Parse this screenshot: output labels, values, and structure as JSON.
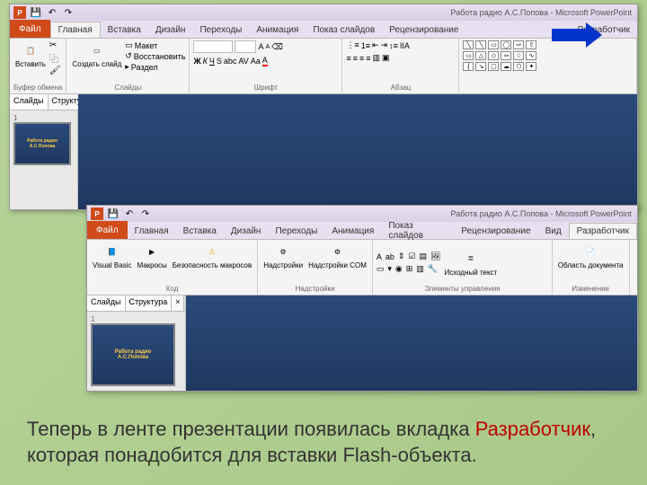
{
  "app": {
    "title1": "Работа радио А.С.Попова - Microsoft PowerPoint",
    "title2": "Работа радио А.С.Попова - Microsoft PowerPoint"
  },
  "tabs": {
    "file": "Файл",
    "home": "Главная",
    "insert": "Вставка",
    "design": "Дизайн",
    "transitions": "Переходы",
    "animations": "Анимация",
    "slideshow": "Показ слайдов",
    "review": "Рецензирование",
    "view": "Вид",
    "developer": "Разработчик"
  },
  "groups": {
    "clipboard": "Буфер обмена",
    "paste": "Вставить",
    "slides": "Слайды",
    "newslide": "Создать слайд",
    "layout": "Макет",
    "reset": "Восстановить",
    "section": "Раздел",
    "font": "Шрифт",
    "paragraph": "Абзац",
    "code": "Код",
    "visualbasic": "Visual Basic",
    "macros": "Макросы",
    "macrosecurity": "Безопасность макросов",
    "addins": "Надстройки",
    "addins1": "Надстройки",
    "comaddins": "Надстройки COM",
    "controls": "Элементы управления",
    "sourcetext": "Исходный текст",
    "modify": "Изменение",
    "docpanel": "Область документа"
  },
  "sidepanel": {
    "slides": "Слайды",
    "outline": "Структура",
    "close": "×"
  },
  "slide": {
    "title": "Работа радио",
    "subtitle": "А.С.Попова"
  },
  "fontformat": {
    "bold": "Ж",
    "italic": "К",
    "underline": "Ч",
    "strike": "S",
    "shadow": "abc"
  },
  "caption": {
    "line1": "Теперь в ленте презентации появилась вкладка ",
    "dev": "Разработчик",
    "line2": ", которая понадобится для вставки Flash-объекта."
  }
}
